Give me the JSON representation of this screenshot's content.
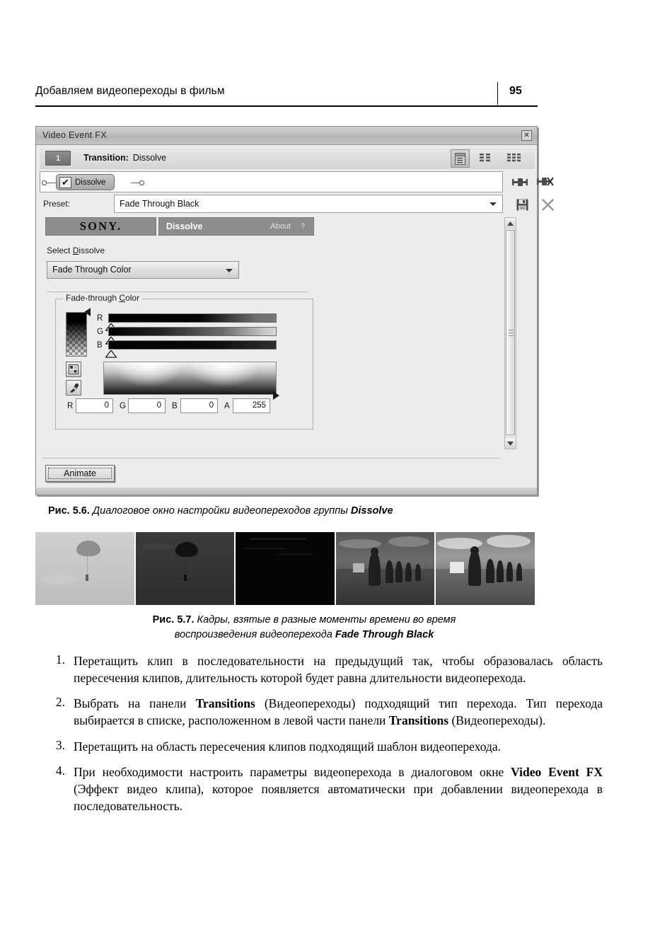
{
  "page": {
    "running_header": "Добавляем видеопереходы в фильм",
    "page_number": "95"
  },
  "dialog": {
    "title": "Video Event FX",
    "close_icon": "✕",
    "chain_number": "1",
    "transition_label": "Transition:",
    "transition_value": "Dissolve",
    "node_label": "Dissolve",
    "node_check": "✔",
    "preset_label": "Preset:",
    "preset_value": "Fade Through Black",
    "plugin": {
      "brand": "SONY.",
      "name": "Dissolve",
      "about": "About",
      "help": "?",
      "select_label": "Select Dissolve",
      "select_label_pre": "Select ",
      "select_label_underline": "D",
      "select_label_post": "issolve",
      "select_value": "Fade Through Color",
      "group_legend": "Fade-through Color",
      "group_legend_pre": "Fade-through ",
      "group_legend_underline": "C",
      "group_legend_post": "olor",
      "channels": [
        {
          "letter": "R",
          "value": 0
        },
        {
          "letter": "G",
          "value": 0
        },
        {
          "letter": "B",
          "value": 0
        }
      ],
      "fields": [
        {
          "label": "R",
          "value": "0"
        },
        {
          "label": "G",
          "value": "0"
        },
        {
          "label": "B",
          "value": "0"
        },
        {
          "label": "A",
          "value": "255"
        }
      ]
    },
    "animate_button": "Animate"
  },
  "figures": {
    "fig56": {
      "number": "Рис. 5.6.",
      "caption": " Диалоговое окно настройки видеопереходов группы ",
      "emphasis": "Dissolve"
    },
    "fig57": {
      "number": "Рис. 5.7.",
      "caption_line1": " Кадры, взятые в разные моменты времени во время",
      "caption_line2": "воспроизведения видеоперехода ",
      "emphasis": "Fade Through Black"
    }
  },
  "steps": [
    {
      "num": "1.",
      "html": "Перетащить клип в последовательности на предыдущий так, чтобы образовалась область пересечения клипов, длительность которой будет равна длительности видеоперехода."
    },
    {
      "num": "2.",
      "html": "Выбрать на панели <b>Transitions</b> (Видеопереходы) подходящий тип перехода. Тип перехода выбирается в списке, расположенном в левой части панели <b>Transitions</b> (Видеопереходы)."
    },
    {
      "num": "3.",
      "html": "Перетащить на область пересечения клипов подходящий шаблон видеоперехода."
    },
    {
      "num": "4.",
      "html": "При необходимости настроить параметры видеоперехода в диалоговом окне <b>Video Event FX</b> (Эффект видео клипа), которое появляется автоматически при добавлении видеоперехода в последовательность."
    }
  ]
}
